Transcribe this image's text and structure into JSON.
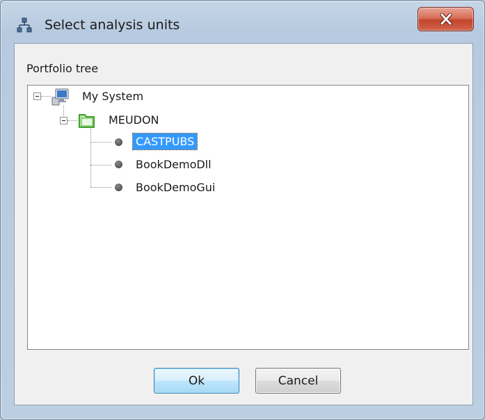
{
  "window": {
    "title": "Select analysis units",
    "title_icon": "hierarchy-icon",
    "close_icon": "close-icon"
  },
  "tree": {
    "label": "Portfolio tree",
    "root": {
      "label": "My System",
      "icon": "computer-icon",
      "expanded": true
    },
    "group": {
      "label": "MEUDON",
      "icon": "folder-icon",
      "expanded": true
    },
    "items": [
      {
        "label": "CASTPUBS",
        "selected": true
      },
      {
        "label": "BookDemoDll",
        "selected": false
      },
      {
        "label": "BookDemoGui",
        "selected": false
      }
    ]
  },
  "buttons": {
    "ok": "Ok",
    "cancel": "Cancel"
  },
  "colors": {
    "selection": "#3399ff",
    "close_button": "#c9503a",
    "frame": "#bccee2"
  }
}
